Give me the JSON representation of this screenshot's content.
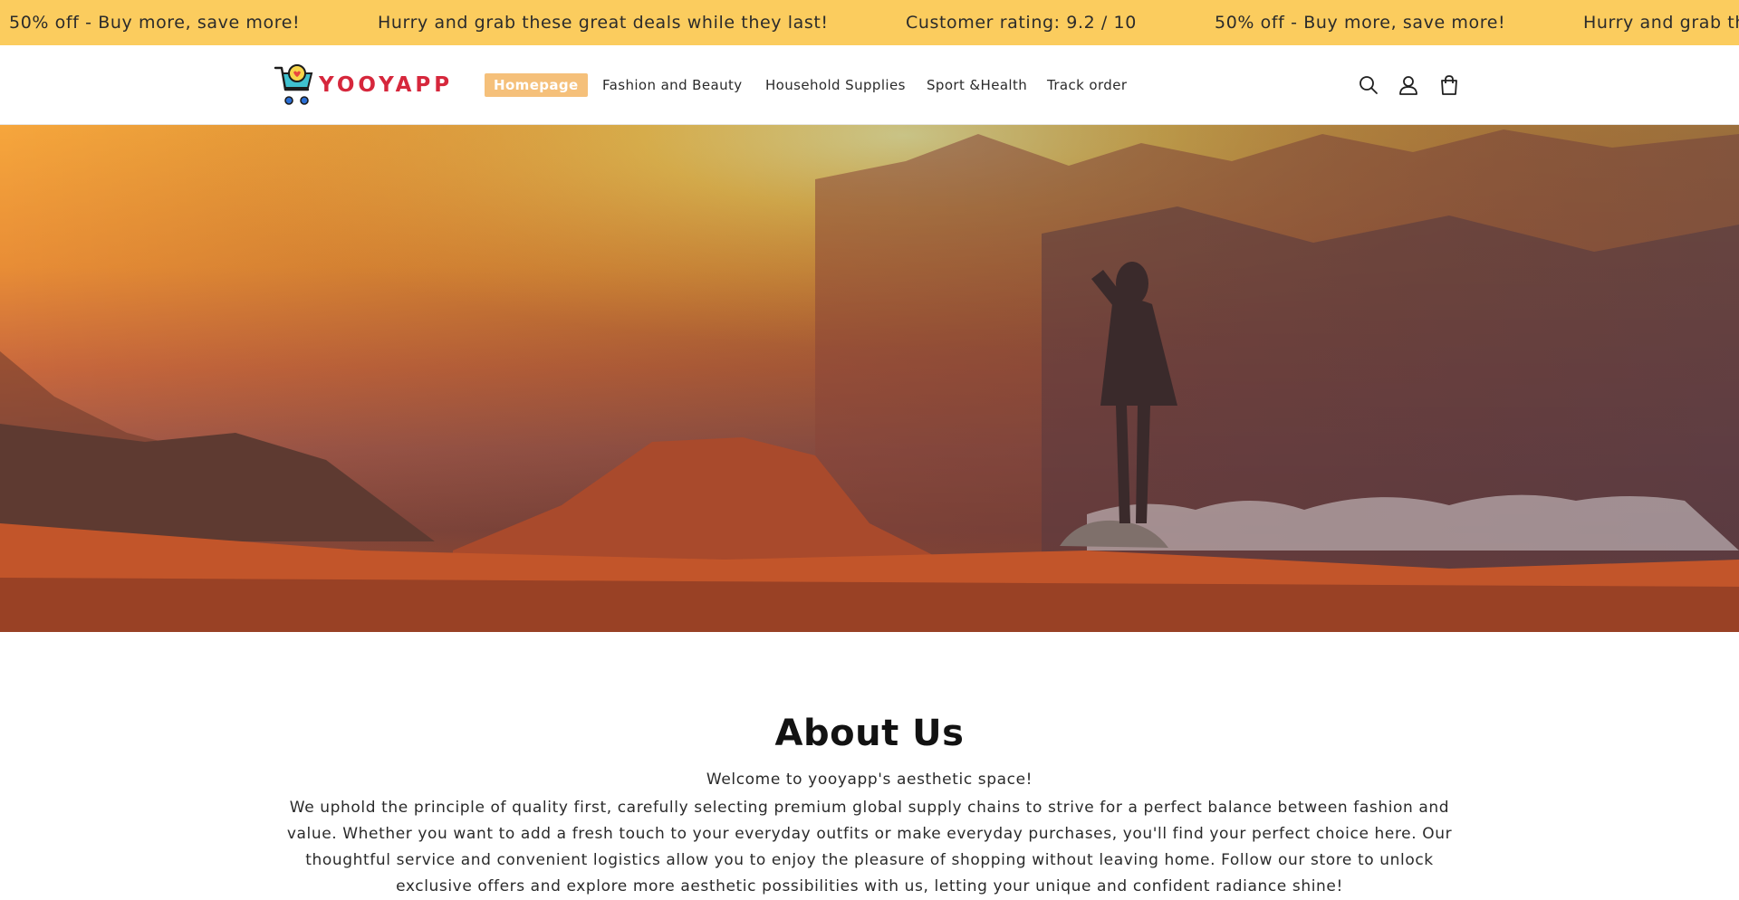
{
  "announcement": {
    "items": [
      "50% off - Buy more, save more!",
      "Hurry and grab these great deals while they last!",
      "Customer rating: 9.2 / 10",
      "50% off - Buy more, save more!",
      "Hurry and grab th"
    ]
  },
  "header": {
    "logo_text": "YOOYAPP",
    "nav": [
      {
        "label": "Homepage",
        "active": true
      },
      {
        "label": "Fashion and Beauty",
        "active": false
      },
      {
        "label": "Household Supplies",
        "active": false
      },
      {
        "label": "Sport &Health",
        "active": false
      },
      {
        "label": "Track order",
        "active": false
      }
    ],
    "icons": [
      "search-icon",
      "account-icon",
      "cart-icon"
    ]
  },
  "about": {
    "title": "About Us",
    "welcome": "Welcome to yooyapp's aesthetic space!",
    "body": "We uphold the principle of quality first, carefully selecting premium global supply chains to strive for a perfect balance between fashion and value. Whether you want to add a fresh touch to your everyday outfits or make everyday purchases, you'll find your perfect choice here. Our thoughtful service and convenient logistics allow you to enjoy the pleasure of shopping without leaving home. Follow our store to unlock exclusive offers and explore more aesthetic possibilities with us, letting your unique and confident radiance shine!"
  },
  "colors": {
    "announcement_bg": "#fbcc5e",
    "active_nav_bg": "#f5c07a",
    "logo_red": "#d6273c",
    "logo_teal": "#2aa7b8"
  }
}
